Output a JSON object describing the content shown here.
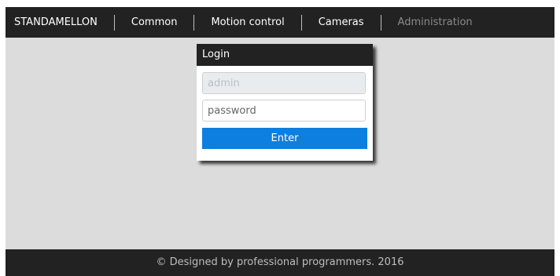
{
  "navbar": {
    "brand": "STANDAMELLON",
    "items": [
      {
        "label": "Common",
        "state": "normal"
      },
      {
        "label": "Motion control",
        "state": "normal"
      },
      {
        "label": "Cameras",
        "state": "normal"
      },
      {
        "label": "Administration",
        "state": "muted"
      }
    ]
  },
  "login": {
    "title": "Login",
    "username_placeholder": "admin",
    "password_placeholder": "password",
    "submit_label": "Enter"
  },
  "footer": {
    "text": "© Designed by professional programmers. 2016"
  },
  "colors": {
    "bar_background": "#222222",
    "page_background": "#dcdcdc",
    "accent": "#0d7fe0"
  }
}
